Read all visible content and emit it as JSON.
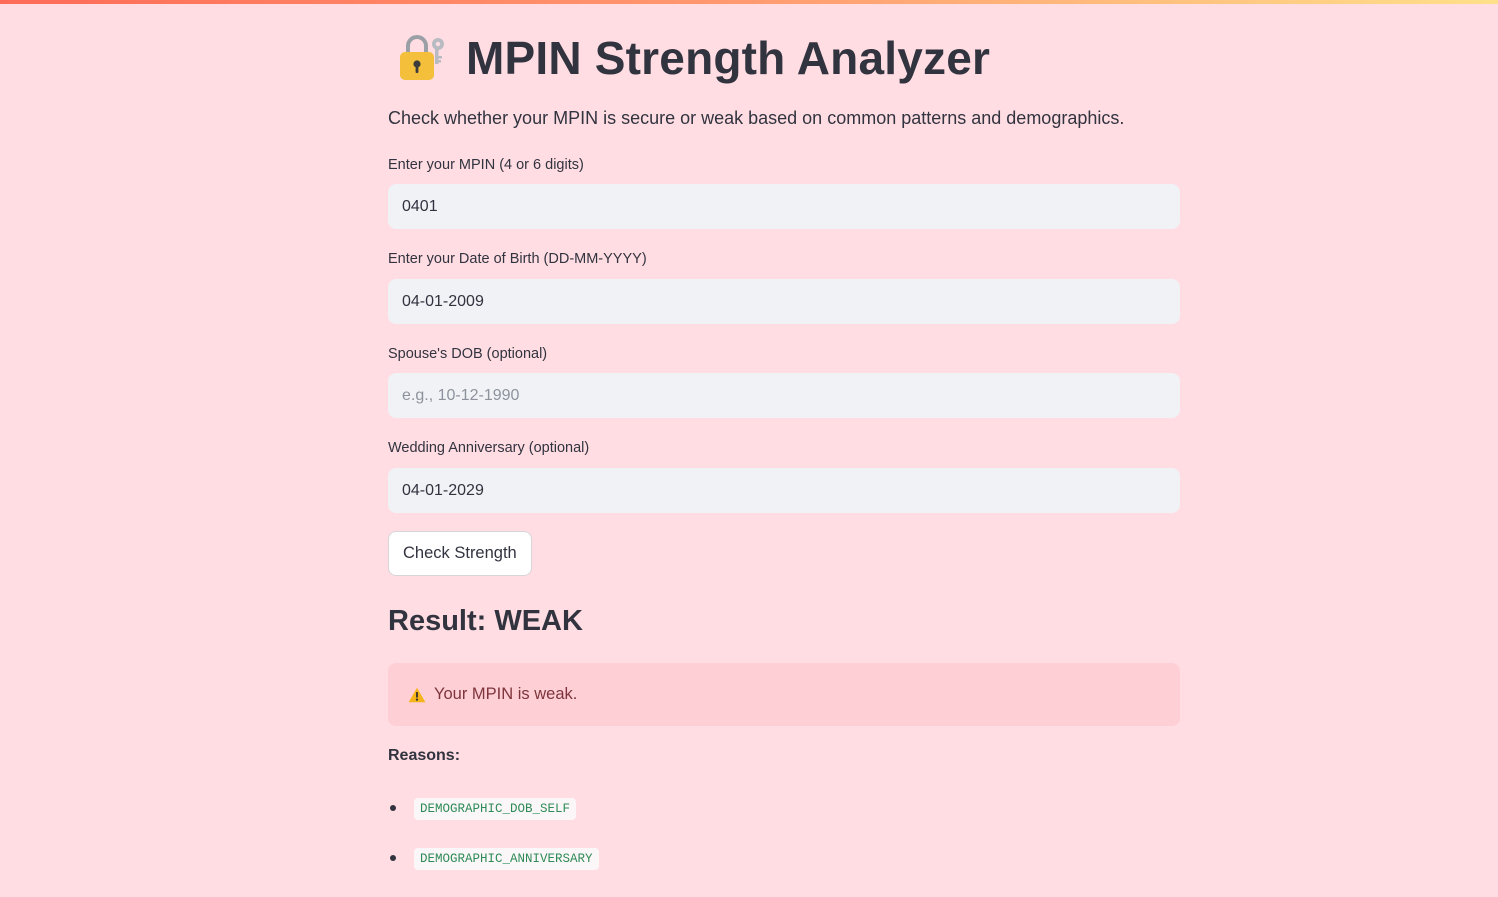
{
  "page": {
    "title": "MPIN Strength Analyzer",
    "title_icon": "lock-with-key-icon",
    "subtitle": "Check whether your MPIN is secure or weak based on common patterns and demographics."
  },
  "form": {
    "mpin": {
      "label": "Enter your MPIN (4 or 6 digits)",
      "value": "0401",
      "placeholder": ""
    },
    "dob": {
      "label": "Enter your Date of Birth (DD-MM-YYYY)",
      "value": "04-01-2009",
      "placeholder": ""
    },
    "spouse_dob": {
      "label": "Spouse's DOB (optional)",
      "value": "",
      "placeholder": "e.g., 10-12-1990"
    },
    "anniversary": {
      "label": "Wedding Anniversary (optional)",
      "value": "04-01-2029",
      "placeholder": ""
    },
    "submit_label": "Check Strength"
  },
  "result": {
    "heading": "Result: WEAK",
    "alert_icon": "warning-icon",
    "alert_text": "Your MPIN is weak.",
    "reasons_label": "Reasons:",
    "reasons": [
      "DEMOGRAPHIC_DOB_SELF",
      "DEMOGRAPHIC_ANNIVERSARY"
    ]
  },
  "colors": {
    "background": "#ffdde3",
    "input_bg": "#f0f2f6",
    "alert_bg": "#ffcfd6",
    "alert_text": "#7d353b",
    "code_text": "#2e8b57"
  }
}
